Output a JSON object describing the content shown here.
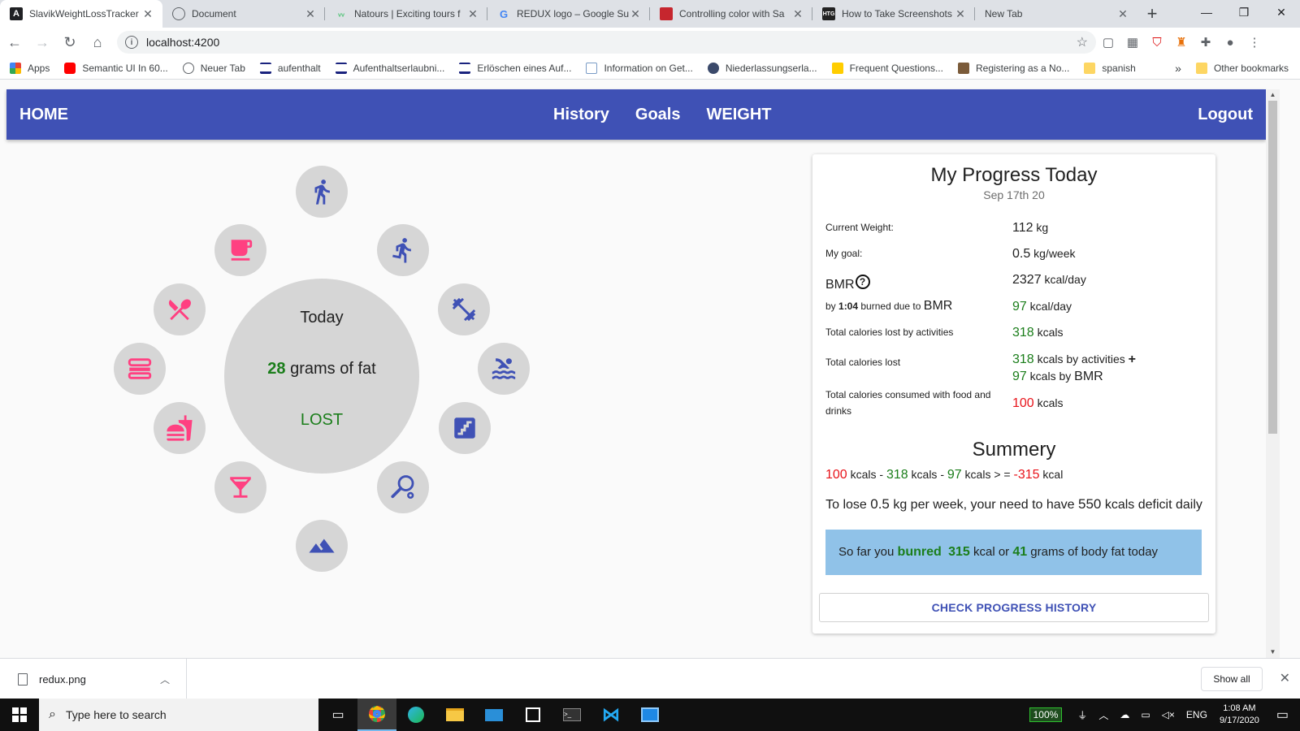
{
  "browser": {
    "tabs": [
      {
        "title": "SlavikWeightLossTracker",
        "active": true
      },
      {
        "title": "Document"
      },
      {
        "title": "Natours | Exciting tours f"
      },
      {
        "title": "REDUX logo – Google Su"
      },
      {
        "title": "Controlling color with Sa"
      },
      {
        "title": "How to Take Screenshots"
      },
      {
        "title": "New Tab"
      }
    ],
    "url": "localhost:4200",
    "bookmarks": [
      "Apps",
      "Semantic UI In 60...",
      "Neuer Tab",
      "aufenthalt",
      "Aufenthaltserlaubni...",
      "Erlöschen eines Auf...",
      "Information on Get...",
      "Niederlassungserla...",
      "Frequent Questions...",
      "Registering as a No...",
      "spanish"
    ],
    "other_bookmarks": "Other bookmarks",
    "overflow": "»"
  },
  "appbar": {
    "home": "HOME",
    "nav": [
      "History",
      "Goals",
      "WEIGHT"
    ],
    "logout": "Logout"
  },
  "wheel": {
    "today": "Today",
    "fat_value": "28",
    "fat_suffix": " grams of fat",
    "lost": "LOST",
    "accent_blue": "#3f51b5",
    "accent_pink": "#ff4081",
    "activities": [
      "directions-walk-icon",
      "directions-run-icon",
      "fitness-center-icon",
      "pool-icon",
      "stairs-icon",
      "tennis-icon",
      "terrain-icon",
      "cocktail-icon",
      "fastfood-icon",
      "cake-icon",
      "restaurant-icon",
      "free-breakfast-icon"
    ]
  },
  "progress": {
    "title": "My Progress Today",
    "date": "Sep 17th 20",
    "current_weight_label": "Current Weight:",
    "current_weight_value": "112",
    "current_weight_unit": " kg",
    "goal_label": "My goal:",
    "goal_value": "0.5",
    "goal_unit": " kg/week",
    "bmr_label": "BMR",
    "bmr_value": "2327",
    "bmr_unit": " kcal/day",
    "burned_prefix": "by ",
    "burned_time": "1:04",
    "burned_mid": " burned due to ",
    "burned_bmr": "BMR",
    "burned_value": "97",
    "burned_unit": "  kcal/day",
    "activities_label": "Total calories lost by activities",
    "activities_value": "318",
    "activities_unit": " kcals",
    "lost_label": "Total calories lost",
    "lost_act_value": "318",
    "lost_act_text": " kcals by activities ",
    "lost_plus": "+",
    "lost_bmr_value": "97",
    "lost_bmr_text": " kcals by ",
    "lost_bmr_word": "BMR",
    "consumed_label": "Total calories consumed with food and drinks",
    "consumed_value": "100",
    "consumed_unit": " kcals"
  },
  "summary": {
    "title": "Summery",
    "f_consumed": "100",
    "f_kcals1": " kcals - ",
    "f_activities": "318",
    "f_kcals2": " kcals - ",
    "f_bmr": "97",
    "f_kcals3": " kcals > = ",
    "f_result": "-315",
    "f_kcal": " kcal",
    "tolose_a": "To lose ",
    "tolose_kg": "0.5",
    "tolose_b": " kg per week, your need to have ",
    "tolose_deficit": "550",
    "tolose_c": " kcals deficit daily",
    "sofar_a": "So far you ",
    "sofar_bunred": "bunred",
    "sofar_kcal": "315",
    "sofar_b": " kcal or ",
    "sofar_grams": "41",
    "sofar_c": " grams of body fat today",
    "button": "CHECK PROGRESS HISTORY"
  },
  "downloads": {
    "file": "redux.png",
    "show_all": "Show all"
  },
  "taskbar": {
    "search_placeholder": "Type here to search",
    "battery": "100%",
    "lang": "ENG",
    "time": "1:08 AM",
    "date": "9/17/2020"
  }
}
